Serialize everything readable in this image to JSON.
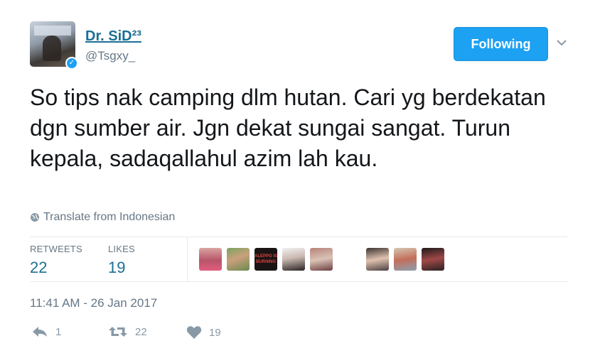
{
  "user": {
    "display_name": "Dr. SiD²³",
    "handle": "@Tsgxy_",
    "verified": true
  },
  "follow_button": {
    "label": "Following",
    "color": "#1da1f2"
  },
  "tweet": {
    "text": "So tips nak camping dlm hutan. Cari yg berdekatan dgn sumber air. Jgn dekat sungai sangat. Turun kepala, sadaqallahul azim lah kau.",
    "translate_label": "Translate from Indonesian",
    "timestamp": "11:41 AM - 26 Jan 2017"
  },
  "stats": {
    "retweets_label": "RETWEETS",
    "retweets_count": "22",
    "likes_label": "LIKES",
    "likes_count": "19"
  },
  "likers": {
    "avatars": [
      "liker-avatar-1",
      "liker-avatar-2",
      "liker-avatar-3",
      "liker-avatar-4",
      "liker-avatar-5",
      "liker-avatar-6",
      "liker-avatar-7",
      "liker-avatar-8"
    ],
    "avatar3_text": "ALEPPO IS BURNING"
  },
  "actions": {
    "reply_count": "1",
    "retweet_count": "22",
    "like_count": "19"
  },
  "icons": [
    "verified-badge-icon",
    "chevron-down-icon",
    "globe-icon",
    "reply-icon",
    "retweet-icon",
    "heart-icon"
  ],
  "colors": {
    "link": "#1b6f95",
    "muted": "#657786",
    "accent": "#1da1f2"
  }
}
